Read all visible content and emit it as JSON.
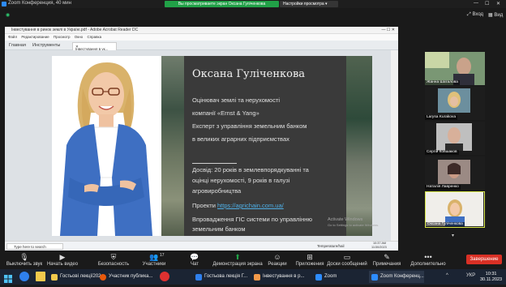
{
  "zoom": {
    "window_title": "Zoom Конференция, 40 мин",
    "share_banner": "Вы просматриваете экран Оксана Гуліченкова",
    "share_settings": "Настройки просмотра",
    "enter_label": "Вход",
    "view_label": "Вид"
  },
  "acrobat": {
    "title": "Інвестування в ринок землі в Україні.pdf - Adobe Acrobat Reader DC",
    "menu": [
      "Файл",
      "Редактирование",
      "Просмотр",
      "Окно",
      "Справка"
    ],
    "tabs": [
      "Главная",
      "Инструменты"
    ],
    "doc_tab": "Інвестування в ук..."
  },
  "slide": {
    "name": "Оксана Гуліченкова",
    "lines": [
      "Оцінювач землі та нерухомості",
      "компанії «Ernst & Yang»",
      "Експерт з управління земельним банком",
      "в великих аграрних підприємствах"
    ],
    "experience": [
      "Досвід: 20 років в землевпорядкуванні та",
      "оцінці нерухомості, 9 років в галузі",
      "агровиробництва"
    ],
    "projects_label": "Проекти",
    "projects_link": "https://agrichain.com.ua/",
    "gis": [
      "Впровадження ГІС системи по управлінню",
      "земельним банком"
    ],
    "activate": "Activate Windows",
    "activate_sub": "Go to Settings to activate Windows."
  },
  "inner_taskbar": {
    "search": "Type here to search",
    "weather": "Temperature/hail",
    "time": "10:37 AM",
    "date": "11/30/2023"
  },
  "participants": [
    {
      "name": "Жанна Шаталова"
    },
    {
      "name": "Larysa Kurakova"
    },
    {
      "name": "Сергій Ковшаков"
    },
    {
      "name": "Наталія Лавренко"
    },
    {
      "name": "Оксана Гуліченкова"
    }
  ],
  "toolbar": {
    "mute": "Выключить звук",
    "video": "Начать видео",
    "security": "Безопасность",
    "participants": "Участники",
    "participants_count": "17",
    "chat": "Чат",
    "share": "Демонстрация экрана",
    "reactions": "Реакции",
    "apps": "Приложения",
    "whiteboard": "Доски сообщений",
    "notes": "Примечания",
    "more": "Дополнительно",
    "end": "Завершение"
  },
  "taskbar": {
    "apps": [
      "Гостьові лекції202...",
      "Участник публика...",
      "Гостьова лекція Г...",
      "Інвестування в р...",
      "Zoom",
      "Zoom Конференц..."
    ],
    "lang": "УКР",
    "time": "10:31",
    "date": "30.11.2023"
  },
  "colors": {
    "share_green": "#21a147",
    "end_red": "#d93025",
    "link_blue": "#4fb0e8"
  }
}
